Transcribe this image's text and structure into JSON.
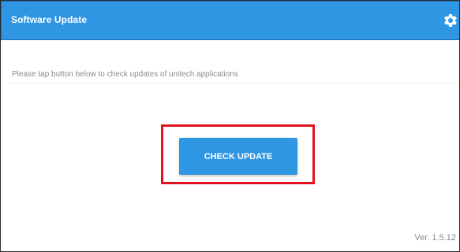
{
  "app_bar": {
    "title": "Software Update",
    "settings_icon": "gear-icon",
    "color": "#2f96e4"
  },
  "content": {
    "message": "Please tap button below to check updates of unitech applications",
    "check_button_label": "CHECK UPDATE",
    "version": "Ver. 1.5.12"
  },
  "annotation": {
    "highlight_color": "#e3121e"
  }
}
